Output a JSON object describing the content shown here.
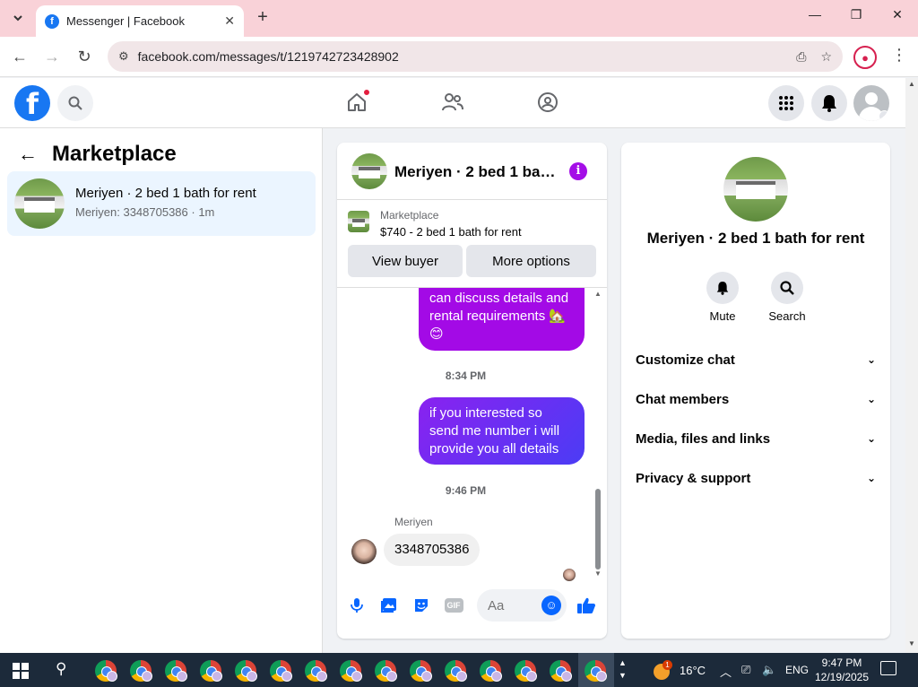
{
  "browser": {
    "tab_title": "Messenger | Facebook",
    "url": "facebook.com/messages/t/1219742723428902"
  },
  "sidebar": {
    "title": "Marketplace",
    "conversations": [
      {
        "name": "Meriyen · 2 bed 1 bath for rent",
        "preview": "Meriyen: 3348705386 · 1m"
      }
    ]
  },
  "chat": {
    "title": "Meriyen · 2 bed 1 bath for rent",
    "listing": {
      "source": "Marketplace",
      "price_line": "$740 - 2 bed 1 bath for rent",
      "view_buyer_label": "View buyer",
      "more_options_label": "More options"
    },
    "messages": [
      {
        "type": "outgoing",
        "text": "can discuss details and rental requirements 🏡 😊"
      },
      {
        "type": "timestamp",
        "text": "8:34 PM"
      },
      {
        "type": "outgoing",
        "text": "if you interested so send me number i will provide you all details"
      },
      {
        "type": "timestamp",
        "text": "9:46 PM"
      },
      {
        "type": "incoming",
        "sender": "Meriyen",
        "text": "3348705386"
      }
    ],
    "composer_placeholder": "Aa",
    "gif_label": "GIF"
  },
  "details": {
    "title": "Meriyen · 2 bed 1 bath for rent",
    "actions": [
      {
        "label": "Mute",
        "icon": "bell-icon"
      },
      {
        "label": "Search",
        "icon": "search-icon"
      }
    ],
    "sections": [
      "Customize chat",
      "Chat members",
      "Media, files and links",
      "Privacy & support"
    ]
  },
  "taskbar": {
    "weather_badge": "1",
    "temperature": "16°C",
    "language": "ENG",
    "time": "9:47 PM",
    "date": "12/19/2025"
  },
  "colors": {
    "brand_blue": "#1877f2",
    "outgoing_purple": "#a30ae6",
    "outgoing_gradient_end": "#4b3cf5",
    "info_purple": "#a40ee7"
  }
}
